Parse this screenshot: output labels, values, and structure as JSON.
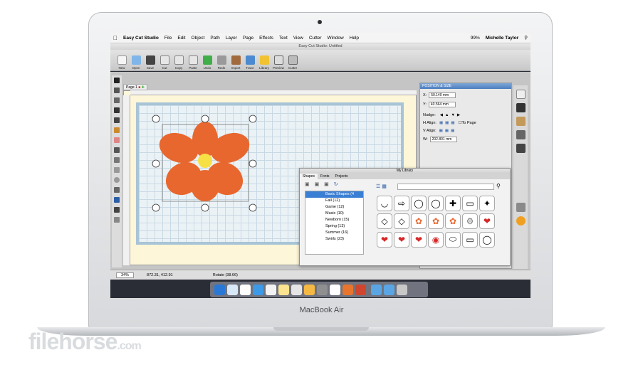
{
  "device": {
    "label": "MacBook Air"
  },
  "watermark": {
    "text": "filehorse",
    "suffix": ".com"
  },
  "menubar": {
    "app": "Easy Cut Studio",
    "items": [
      "File",
      "Edit",
      "Object",
      "Path",
      "Layer",
      "Page",
      "Effects",
      "Text",
      "View",
      "Cutter",
      "Window",
      "Help"
    ],
    "battery": "99%",
    "user": "Michelle Taylor"
  },
  "window": {
    "title": "Easy Cut Studio: Untitled"
  },
  "toolbar": {
    "buttons": [
      "New",
      "Open",
      "Save",
      "Cut",
      "Copy",
      "Paste",
      "Undo",
      "Redo",
      "Import",
      "Trace",
      "Library",
      "Preview",
      "Cutter"
    ]
  },
  "page_tab": {
    "label": "Page 1"
  },
  "position_panel": {
    "title": "POSITION & SIZE",
    "x_label": "X:",
    "x_value": "50.140 mm",
    "y_label": "Y:",
    "y_value": "40.564 mm",
    "nudge_label": "Nudge:",
    "halign_label": "H Align:",
    "valign_label": "V Align:",
    "to_page_label": "To Page",
    "w_label": "W:",
    "w_value": "202.801 mm"
  },
  "library": {
    "title": "My Library",
    "tabs": [
      "Shapes",
      "Fonts",
      "Projects"
    ],
    "tree": [
      "Basic Shapes (4",
      "Fall (12)",
      "Game (12)",
      "Music (10)",
      "Newborn (15)",
      "Spring (13)",
      "Summer (16)",
      "Swirls (23)"
    ]
  },
  "status": {
    "zoom": "34%",
    "coords": "872.31, 412.91",
    "rotate": "Rotate (38.66)"
  }
}
